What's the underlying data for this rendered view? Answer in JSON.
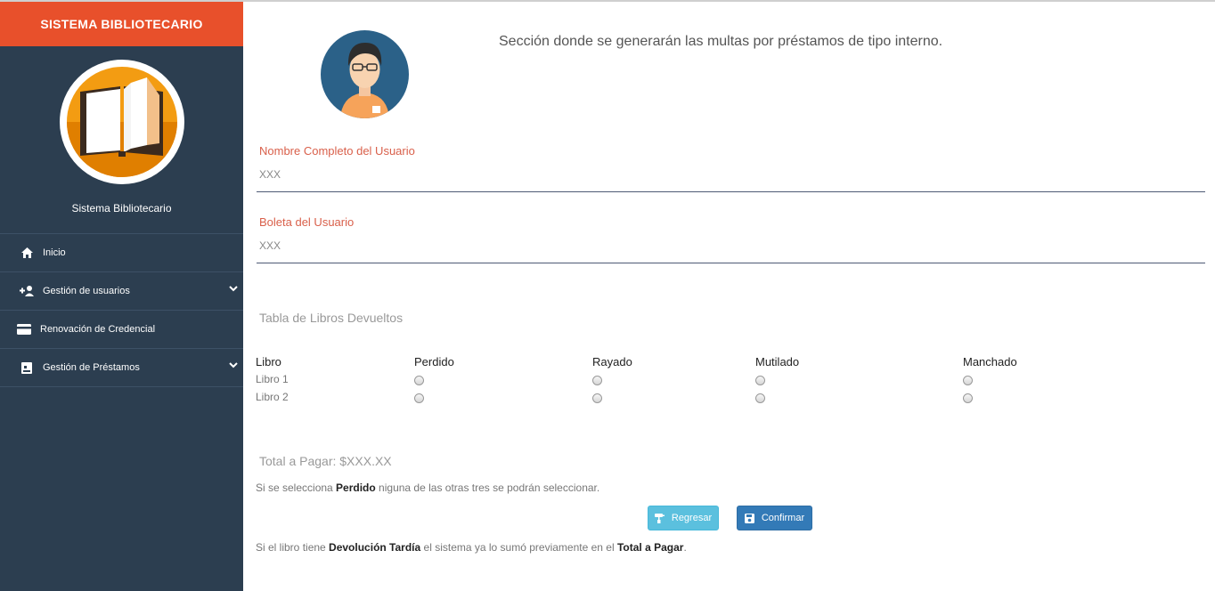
{
  "sidebar": {
    "brand": "SISTEMA BIBLIOTECARIO",
    "title": "Sistema Bibliotecario",
    "items": [
      {
        "label": "Inicio",
        "icon": "home-icon"
      },
      {
        "label": "Gestión de usuarios",
        "icon": "user-plus-icon",
        "has_submenu": true
      },
      {
        "label": "Renovación de Credencial",
        "icon": "credit-card-icon"
      },
      {
        "label": "Gestión de Préstamos",
        "icon": "image-icon",
        "has_submenu": true
      }
    ]
  },
  "main": {
    "heading": "Sección donde se generarán las multas por préstamos de tipo interno.",
    "fields": [
      {
        "label": "Nombre Completo del Usuario",
        "value": "XXX"
      },
      {
        "label": "Boleta del Usuario",
        "value": "XXX"
      }
    ],
    "table": {
      "title": "Tabla de Libros Devueltos",
      "columns": [
        "Libro",
        "Perdido",
        "Rayado",
        "Mutilado",
        "Manchado"
      ],
      "rows": [
        "Libro 1",
        "Libro 2"
      ]
    },
    "total": "Total a Pagar: $XXX.XX",
    "note1": {
      "pre": "Si se selecciona ",
      "bold": "Perdido",
      "post": " niguna de las otras tres se podrán seleccionar."
    },
    "buttons": {
      "back": "Regresar",
      "confirm": "Confirmar"
    },
    "note2": {
      "pre": "Si el libro tiene ",
      "bold1": "Devolución Tardía",
      "mid": " el sistema ya lo sumó previamente en el ",
      "bold2": "Total a Pagar",
      "post": "."
    }
  },
  "colors": {
    "brand": "#e8502b",
    "sidebar": "#2c3e50",
    "label": "#d9604b",
    "btn_back": "#5bc0de",
    "btn_confirm": "#337ab7"
  }
}
